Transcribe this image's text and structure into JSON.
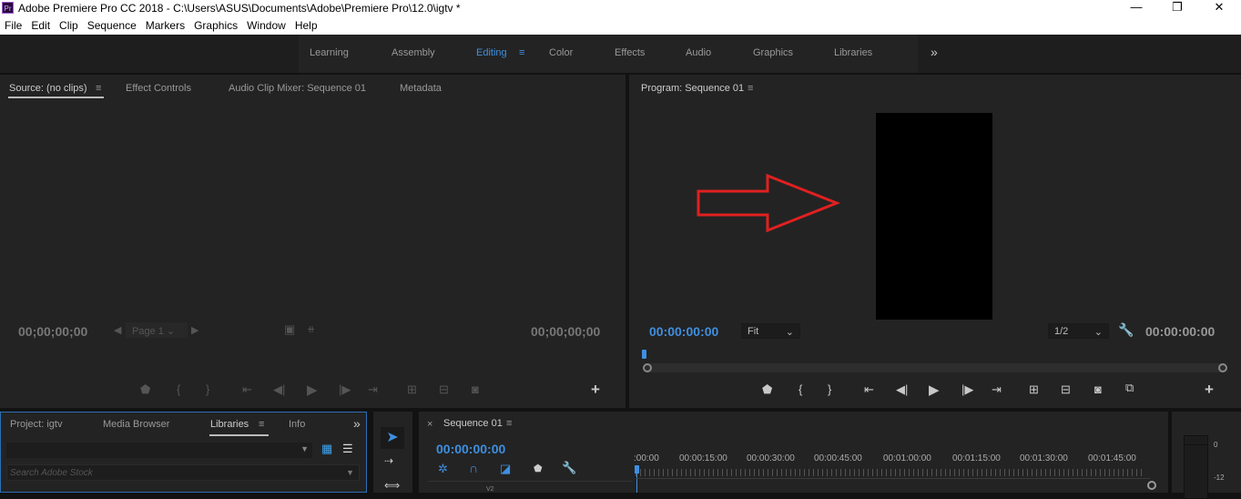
{
  "window": {
    "title": "Adobe Premiere Pro CC 2018 - C:\\Users\\ASUS\\Documents\\Adobe\\Premiere Pro\\12.0\\igtv *",
    "logo": "Pr",
    "minimize": "—",
    "maximize": "❐",
    "close": "✕"
  },
  "menu": [
    "File",
    "Edit",
    "Clip",
    "Sequence",
    "Markers",
    "Graphics",
    "Window",
    "Help"
  ],
  "workspaces": {
    "items": [
      "Learning",
      "Assembly",
      "Editing",
      "Color",
      "Effects",
      "Audio",
      "Graphics",
      "Libraries"
    ],
    "active": "Editing",
    "more": "»"
  },
  "source": {
    "tabs": [
      "Source: (no clips)",
      "Effect Controls",
      "Audio Clip Mixer: Sequence 01",
      "Metadata"
    ],
    "menu": "≡",
    "tc_left": "00;00;00;00",
    "tc_right": "00;00;00;00",
    "page": "Page 1",
    "add": "+"
  },
  "program": {
    "title": "Program: Sequence 01",
    "menu": "≡",
    "tc_left": "00:00:00:00",
    "zoom": "Fit",
    "resolution": "1/2",
    "tc_right": "00:00:00:00",
    "add": "+"
  },
  "project": {
    "tabs": [
      "Project: igtv",
      "Media Browser",
      "Libraries",
      "Info"
    ],
    "active": "Libraries",
    "menu": "≡",
    "more": "»",
    "search_placeholder": "Search Adobe Stock"
  },
  "timeline": {
    "title": "Sequence 01",
    "close": "×",
    "menu": "≡",
    "timecode": "00:00:00:00",
    "ruler": [
      ":00:00",
      "00:00:15:00",
      "00:00:30:00",
      "00:00:45:00",
      "00:01:00:00",
      "00:01:15:00",
      "00:01:30:00",
      "00:01:45:00"
    ],
    "track_label": "V2"
  },
  "meter": {
    "labels": [
      "0",
      "-12"
    ]
  },
  "colors": {
    "accent": "#3f8fe0",
    "arrow": "#e02020"
  }
}
